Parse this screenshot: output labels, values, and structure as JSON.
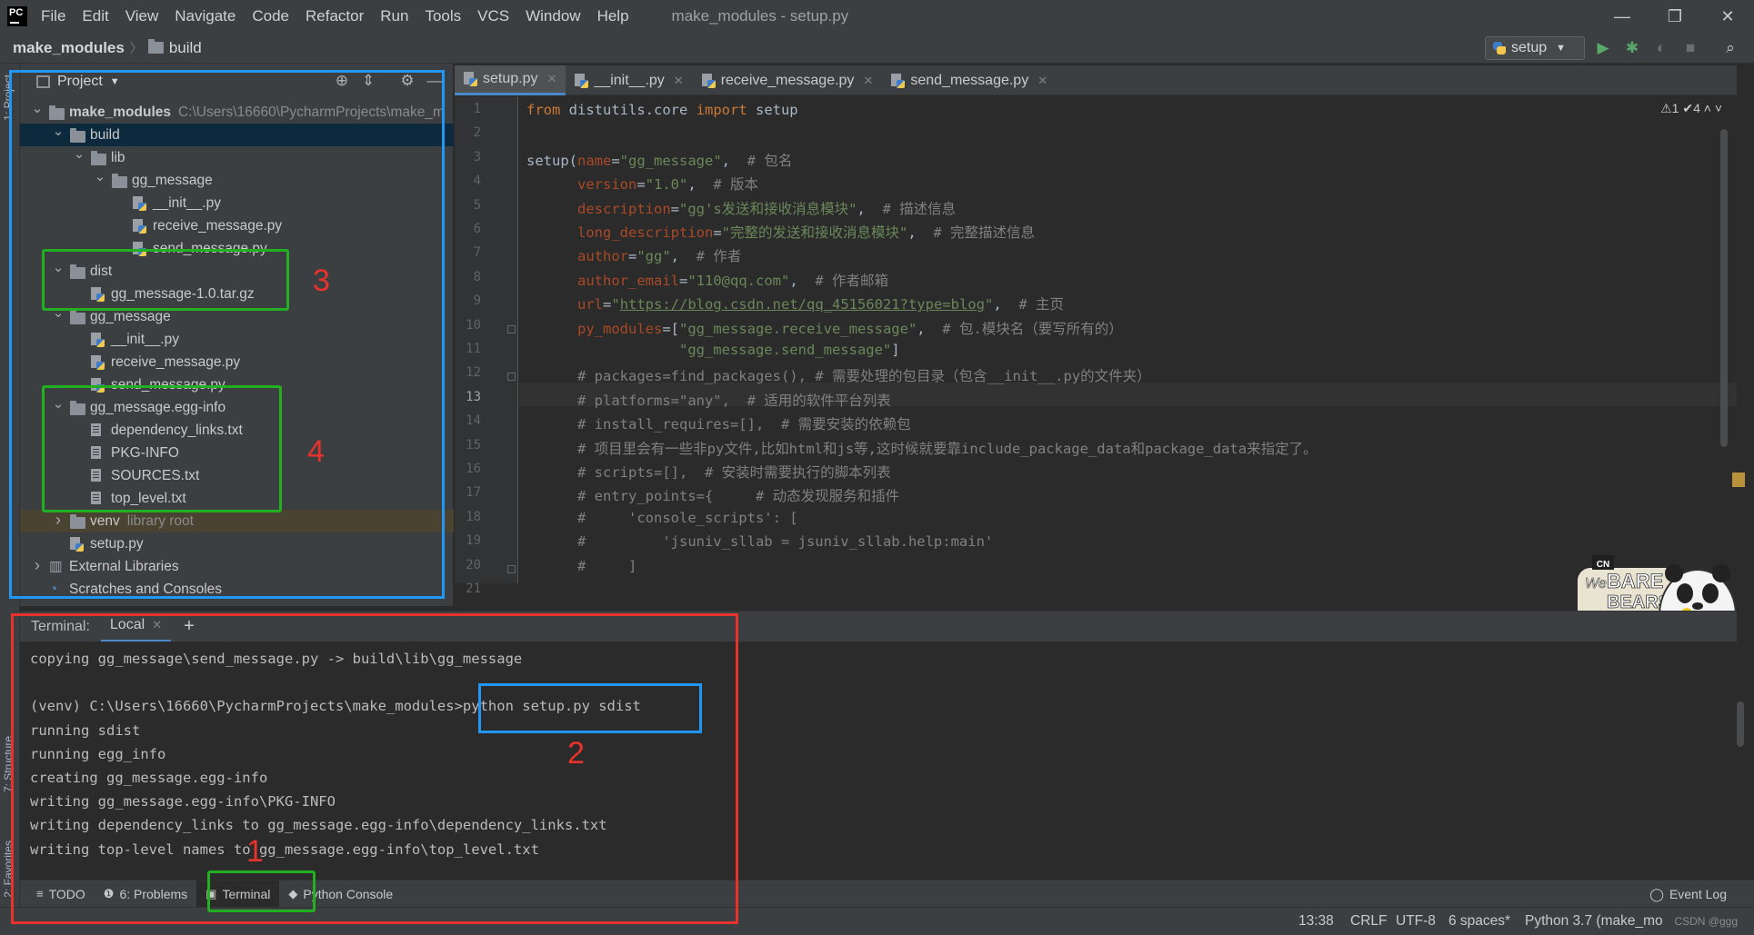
{
  "window": {
    "logo_text": "PC",
    "title": "make_modules - setup.py",
    "menu": [
      "File",
      "Edit",
      "View",
      "Navigate",
      "Code",
      "Refactor",
      "Run",
      "Tools",
      "VCS",
      "Window",
      "Help"
    ],
    "controls": {
      "minimize": "—",
      "restore": "❐",
      "close": "✕"
    }
  },
  "navbar": {
    "crumbs": [
      "make_modules",
      "build"
    ],
    "run_config": "setup",
    "icons": [
      "run-icon",
      "debug-icon",
      "coverage-icon",
      "stop-icon",
      "search-icon"
    ]
  },
  "left_strip": {
    "project_label": "1: Project",
    "structure_label": "7: Structure",
    "favorites_label": "2: Favorites"
  },
  "project_panel": {
    "title": "Project",
    "tree": [
      {
        "depth": 0,
        "expanded": true,
        "icon": "folder",
        "label": "make_modules",
        "hint": "C:\\Users\\16660\\PycharmProjects\\make_m",
        "bold": true
      },
      {
        "depth": 1,
        "expanded": true,
        "icon": "folder",
        "label": "build",
        "selected": true
      },
      {
        "depth": 2,
        "expanded": true,
        "icon": "folder",
        "label": "lib"
      },
      {
        "depth": 3,
        "expanded": true,
        "icon": "folder",
        "label": "gg_message"
      },
      {
        "depth": 4,
        "icon": "pyfile",
        "label": "__init__.py"
      },
      {
        "depth": 4,
        "icon": "pyfile",
        "label": "receive_message.py"
      },
      {
        "depth": 4,
        "icon": "pyfile",
        "label": "send_message.py"
      },
      {
        "depth": 1,
        "expanded": true,
        "icon": "folder",
        "label": "dist"
      },
      {
        "depth": 2,
        "icon": "pyfile",
        "label": "gg_message-1.0.tar.gz"
      },
      {
        "depth": 1,
        "expanded": true,
        "icon": "folder",
        "label": "gg_message"
      },
      {
        "depth": 2,
        "icon": "pyfile",
        "label": "__init__.py"
      },
      {
        "depth": 2,
        "icon": "pyfile",
        "label": "receive_message.py"
      },
      {
        "depth": 2,
        "icon": "pyfile",
        "label": "send_message.py"
      },
      {
        "depth": 1,
        "expanded": true,
        "icon": "folder",
        "label": "gg_message.egg-info"
      },
      {
        "depth": 2,
        "icon": "file",
        "label": "dependency_links.txt"
      },
      {
        "depth": 2,
        "icon": "file",
        "label": "PKG-INFO"
      },
      {
        "depth": 2,
        "icon": "file",
        "label": "SOURCES.txt"
      },
      {
        "depth": 2,
        "icon": "file",
        "label": "top_level.txt"
      },
      {
        "depth": 1,
        "expanded": false,
        "icon": "folder",
        "label": "venv",
        "hint": "library root",
        "venv": true
      },
      {
        "depth": 1,
        "icon": "pyfile",
        "label": "setup.py"
      },
      {
        "depth": 0,
        "expanded": false,
        "icon": "libs",
        "label": "External Libraries"
      },
      {
        "depth": 0,
        "icon": "scratch",
        "label": "Scratches and Consoles"
      }
    ]
  },
  "editor": {
    "tabs": [
      {
        "label": "setup.py",
        "active": true
      },
      {
        "label": "__init__.py"
      },
      {
        "label": "receive_message.py"
      },
      {
        "label": "send_message.py"
      }
    ],
    "inspections": "⚠1  ✔4  ˄  ˅",
    "current_line": 13,
    "lines": [
      {
        "n": "1",
        "segs": [
          [
            "kw",
            "from "
          ],
          [
            "plain",
            "distutils.core "
          ],
          [
            "kw",
            "import "
          ],
          [
            "plain",
            "setup"
          ]
        ]
      },
      {
        "n": "2",
        "segs": []
      },
      {
        "n": "3",
        "segs": [
          [
            "plain",
            "setup("
          ],
          [
            "param",
            "name"
          ],
          [
            "plain",
            "="
          ],
          [
            "str",
            "\"gg_message\""
          ],
          [
            "plain",
            ",  "
          ],
          [
            "comment",
            "# 包名"
          ]
        ]
      },
      {
        "n": "4",
        "segs": [
          [
            "plain",
            "      "
          ],
          [
            "param",
            "version"
          ],
          [
            "plain",
            "="
          ],
          [
            "str",
            "\"1.0\""
          ],
          [
            "plain",
            ",  "
          ],
          [
            "comment",
            "# 版本"
          ]
        ]
      },
      {
        "n": "5",
        "segs": [
          [
            "plain",
            "      "
          ],
          [
            "param",
            "description"
          ],
          [
            "plain",
            "="
          ],
          [
            "str",
            "\"gg's发送和接收消息模块\""
          ],
          [
            "plain",
            ",  "
          ],
          [
            "comment",
            "# 描述信息"
          ]
        ]
      },
      {
        "n": "6",
        "segs": [
          [
            "plain",
            "      "
          ],
          [
            "param",
            "long_description"
          ],
          [
            "plain",
            "="
          ],
          [
            "str",
            "\"完整的发送和接收消息模块\""
          ],
          [
            "plain",
            ",  "
          ],
          [
            "comment",
            "# 完整描述信息"
          ]
        ]
      },
      {
        "n": "7",
        "segs": [
          [
            "plain",
            "      "
          ],
          [
            "param",
            "author"
          ],
          [
            "plain",
            "="
          ],
          [
            "str",
            "\"gg\""
          ],
          [
            "plain",
            ",  "
          ],
          [
            "comment",
            "# 作者"
          ]
        ]
      },
      {
        "n": "8",
        "segs": [
          [
            "plain",
            "      "
          ],
          [
            "param",
            "author_email"
          ],
          [
            "plain",
            "="
          ],
          [
            "str",
            "\"110@qq.com\""
          ],
          [
            "plain",
            ",  "
          ],
          [
            "comment",
            "# 作者邮箱"
          ]
        ]
      },
      {
        "n": "9",
        "segs": [
          [
            "plain",
            "      "
          ],
          [
            "param",
            "url"
          ],
          [
            "plain",
            "="
          ],
          [
            "str",
            "\""
          ],
          [
            "url",
            "https://blog.csdn.net/qq_45156021?type=blog"
          ],
          [
            "str",
            "\""
          ],
          [
            "plain",
            ",  "
          ],
          [
            "comment",
            "# 主页"
          ]
        ]
      },
      {
        "n": "10",
        "segs": [
          [
            "plain",
            "      "
          ],
          [
            "param",
            "py_modules"
          ],
          [
            "plain",
            "=["
          ],
          [
            "str",
            "\"gg_message.receive_message\""
          ],
          [
            "plain",
            ",  "
          ],
          [
            "comment",
            "# 包.模块名（要写所有的）"
          ]
        ]
      },
      {
        "n": "11",
        "segs": [
          [
            "plain",
            "                  "
          ],
          [
            "str",
            "\"gg_message.send_message\""
          ],
          [
            "plain",
            "]"
          ]
        ]
      },
      {
        "n": "12",
        "segs": [
          [
            "plain",
            "      "
          ],
          [
            "comment",
            "# packages=find_packages(), # 需要处理的包目录（包含__init__.py的文件夹）"
          ]
        ]
      },
      {
        "n": "13",
        "segs": [
          [
            "plain",
            "      "
          ],
          [
            "comment",
            "# platforms=\"any\",  # 适用的软件平台列表"
          ]
        ]
      },
      {
        "n": "14",
        "segs": [
          [
            "plain",
            "      "
          ],
          [
            "comment",
            "# install_requires=[],  # 需要安装的依赖包"
          ]
        ]
      },
      {
        "n": "15",
        "segs": [
          [
            "plain",
            "      "
          ],
          [
            "comment",
            "# 项目里会有一些非py文件,比如html和js等,这时候就要靠include_package_data和package_data来指定了。"
          ]
        ]
      },
      {
        "n": "16",
        "segs": [
          [
            "plain",
            "      "
          ],
          [
            "comment",
            "# scripts=[],  # 安装时需要执行的脚本列表"
          ]
        ]
      },
      {
        "n": "17",
        "segs": [
          [
            "plain",
            "      "
          ],
          [
            "comment",
            "# entry_points={     # 动态发现服务和插件"
          ]
        ]
      },
      {
        "n": "18",
        "segs": [
          [
            "plain",
            "      "
          ],
          [
            "comment",
            "#     'console_scripts': ["
          ]
        ]
      },
      {
        "n": "19",
        "segs": [
          [
            "plain",
            "      "
          ],
          [
            "comment",
            "#         'jsuniv_sllab = jsuniv_sllab.help:main'"
          ]
        ]
      },
      {
        "n": "20",
        "segs": [
          [
            "plain",
            "      "
          ],
          [
            "comment",
            "#     ]"
          ]
        ]
      },
      {
        "n": "21",
        "segs": [
          [
            "plain",
            "      "
          ],
          [
            "comment",
            "}"
          ]
        ]
      }
    ]
  },
  "terminal": {
    "label": "Terminal:",
    "tab": "Local",
    "add": "+",
    "lines": [
      "copying gg_message\\send_message.py -> build\\lib\\gg_message",
      "",
      "(venv) C:\\Users\\16660\\PycharmProjects\\make_modules>python setup.py sdist",
      "running sdist",
      "running egg_info",
      "creating gg_message.egg-info",
      "writing gg_message.egg-info\\PKG-INFO",
      "writing dependency_links to gg_message.egg-info\\dependency_links.txt",
      "writing top-level names to gg_message.egg-info\\top_level.txt"
    ]
  },
  "tool_windows": [
    {
      "label": "TODO",
      "icon": "≡"
    },
    {
      "label": "6: Problems",
      "icon": "❶"
    },
    {
      "label": "Terminal",
      "icon": "▣",
      "active": true
    },
    {
      "label": "Python Console",
      "icon": "◆"
    }
  ],
  "event_log": "Event Log",
  "status": {
    "position": "13:38",
    "line_sep": "CRLF",
    "encoding": "UTF-8",
    "indent": "6 spaces*",
    "interpreter": "Python 3.7 (make_mo",
    "watermark": "CSDN @ggg"
  },
  "mascot": {
    "logo": "CN",
    "brand_top": "We",
    "brand_main": "BARE",
    "brand_sub": "BEARS",
    "ime": "英"
  },
  "annotations": {
    "n1": "1",
    "n2": "2",
    "n3": "3",
    "n4": "4"
  }
}
